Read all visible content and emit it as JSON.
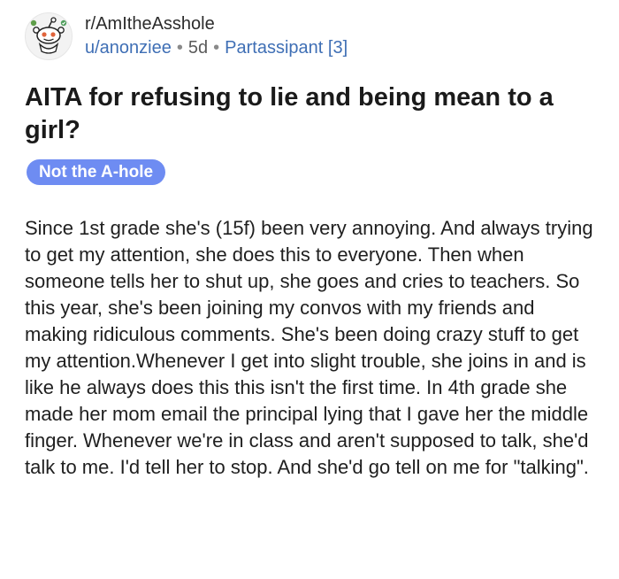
{
  "header": {
    "subreddit": "r/AmItheAsshole",
    "author": "u/anonziee",
    "separator": "•",
    "age": "5d",
    "user_flair": "Partassipant [3]",
    "avatar_icon": "snoo-mascot-icon"
  },
  "post": {
    "title": "AITA for refusing to lie and being mean to a girl?",
    "flair": "Not the A-hole",
    "body": "Since 1st grade she's (15f) been very annoying. And always trying to get my attention, she does this to everyone. Then when someone tells her to shut up, she goes and cries to teachers. So this year, she's been joining my convos with my friends and making ridiculous comments. She's been doing crazy stuff to get my attention.Whenever I get into slight trouble, she joins in and is like he always does this this isn't the first time. In 4th grade she made her mom email the principal lying that I gave her the middle finger. Whenever we're in class and aren't supposed to talk, she'd talk to me. I'd tell her to stop. And she'd go tell on me for \"talking\"."
  },
  "colors": {
    "link": "#3f6fb5",
    "flair_bg": "#6e8cf2",
    "flair_text": "#ffffff"
  }
}
